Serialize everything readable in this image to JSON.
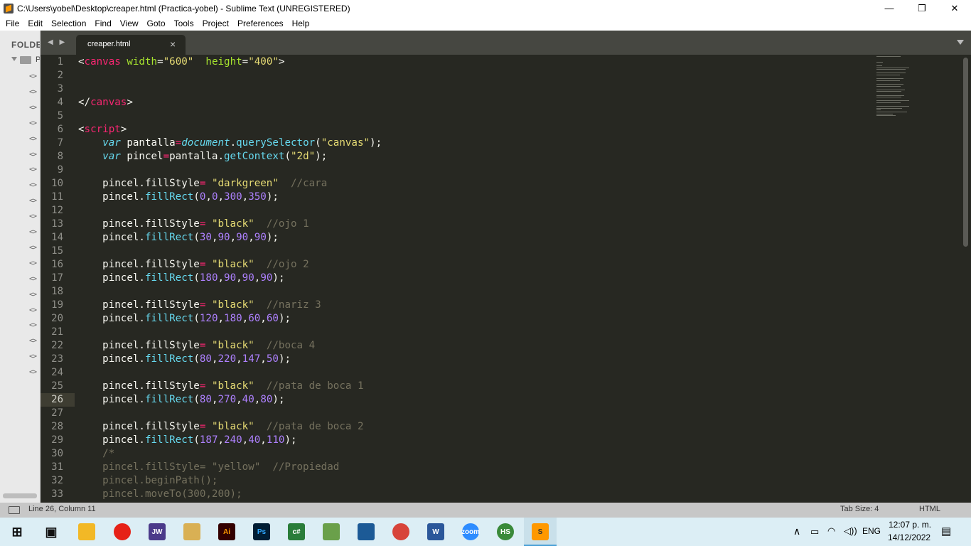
{
  "window": {
    "title": "C:\\Users\\yobel\\Desktop\\creaper.html (Practica-yobel) - Sublime Text (UNREGISTERED)",
    "minimize": "—",
    "maximize": "❐",
    "close": "✕"
  },
  "menu": [
    "File",
    "Edit",
    "Selection",
    "Find",
    "View",
    "Goto",
    "Tools",
    "Project",
    "Preferences",
    "Help"
  ],
  "sidebar": {
    "header": "FOLDE",
    "folder_letter": "P",
    "file_icon_glyph": "<>",
    "file_count": 20
  },
  "tabs": {
    "nav": "◀ ▶",
    "active_tab": "creaper.html",
    "close_glyph": "×"
  },
  "editor": {
    "current_line": 26,
    "lines": [
      [
        [
          "t-plain",
          "<"
        ],
        [
          "t-tag",
          "canvas"
        ],
        [
          "t-plain",
          " "
        ],
        [
          "t-attr",
          "width"
        ],
        [
          "t-plain",
          "="
        ],
        [
          "t-str",
          "\"600\""
        ],
        [
          "t-plain",
          "  "
        ],
        [
          "t-attr",
          "height"
        ],
        [
          "t-plain",
          "="
        ],
        [
          "t-str",
          "\"400\""
        ],
        [
          "t-plain",
          ">"
        ]
      ],
      [],
      [],
      [
        [
          "t-plain",
          "</"
        ],
        [
          "t-tag",
          "canvas"
        ],
        [
          "t-plain",
          ">"
        ]
      ],
      [],
      [
        [
          "t-plain",
          "<"
        ],
        [
          "t-tag",
          "script"
        ],
        [
          "t-plain",
          ">"
        ]
      ],
      [
        [
          "t-plain",
          "    "
        ],
        [
          "t-kw",
          "var"
        ],
        [
          "t-plain",
          " pantalla"
        ],
        [
          "t-op",
          "="
        ],
        [
          "t-glob",
          "document"
        ],
        [
          "t-plain",
          "."
        ],
        [
          "t-fn",
          "querySelector"
        ],
        [
          "t-plain",
          "("
        ],
        [
          "t-str",
          "\"canvas\""
        ],
        [
          "t-plain",
          ");"
        ]
      ],
      [
        [
          "t-plain",
          "    "
        ],
        [
          "t-kw",
          "var"
        ],
        [
          "t-plain",
          " pincel"
        ],
        [
          "t-op",
          "="
        ],
        [
          "t-plain",
          "pantalla."
        ],
        [
          "t-fn",
          "getContext"
        ],
        [
          "t-plain",
          "("
        ],
        [
          "t-str",
          "\"2d\""
        ],
        [
          "t-plain",
          ");"
        ]
      ],
      [],
      [
        [
          "t-plain",
          "    pincel.fillStyle"
        ],
        [
          "t-op",
          "="
        ],
        [
          "t-plain",
          " "
        ],
        [
          "t-str",
          "\"darkgreen\""
        ],
        [
          "t-plain",
          "  "
        ],
        [
          "t-com",
          "//cara"
        ]
      ],
      [
        [
          "t-plain",
          "    pincel."
        ],
        [
          "t-fn",
          "fillRect"
        ],
        [
          "t-plain",
          "("
        ],
        [
          "t-num",
          "0"
        ],
        [
          "t-plain",
          ","
        ],
        [
          "t-num",
          "0"
        ],
        [
          "t-plain",
          ","
        ],
        [
          "t-num",
          "300"
        ],
        [
          "t-plain",
          ","
        ],
        [
          "t-num",
          "350"
        ],
        [
          "t-plain",
          ");"
        ]
      ],
      [],
      [
        [
          "t-plain",
          "    pincel.fillStyle"
        ],
        [
          "t-op",
          "="
        ],
        [
          "t-plain",
          " "
        ],
        [
          "t-str",
          "\"black\""
        ],
        [
          "t-plain",
          "  "
        ],
        [
          "t-com",
          "//ojo 1"
        ]
      ],
      [
        [
          "t-plain",
          "    pincel."
        ],
        [
          "t-fn",
          "fillRect"
        ],
        [
          "t-plain",
          "("
        ],
        [
          "t-num",
          "30"
        ],
        [
          "t-plain",
          ","
        ],
        [
          "t-num",
          "90"
        ],
        [
          "t-plain",
          ","
        ],
        [
          "t-num",
          "90"
        ],
        [
          "t-plain",
          ","
        ],
        [
          "t-num",
          "90"
        ],
        [
          "t-plain",
          ");"
        ]
      ],
      [],
      [
        [
          "t-plain",
          "    pincel.fillStyle"
        ],
        [
          "t-op",
          "="
        ],
        [
          "t-plain",
          " "
        ],
        [
          "t-str",
          "\"black\""
        ],
        [
          "t-plain",
          "  "
        ],
        [
          "t-com",
          "//ojo 2"
        ]
      ],
      [
        [
          "t-plain",
          "    pincel."
        ],
        [
          "t-fn",
          "fillRect"
        ],
        [
          "t-plain",
          "("
        ],
        [
          "t-num",
          "180"
        ],
        [
          "t-plain",
          ","
        ],
        [
          "t-num",
          "90"
        ],
        [
          "t-plain",
          ","
        ],
        [
          "t-num",
          "90"
        ],
        [
          "t-plain",
          ","
        ],
        [
          "t-num",
          "90"
        ],
        [
          "t-plain",
          ");"
        ]
      ],
      [],
      [
        [
          "t-plain",
          "    pincel.fillStyle"
        ],
        [
          "t-op",
          "="
        ],
        [
          "t-plain",
          " "
        ],
        [
          "t-str",
          "\"black\""
        ],
        [
          "t-plain",
          "  "
        ],
        [
          "t-com",
          "//nariz 3"
        ]
      ],
      [
        [
          "t-plain",
          "    pincel."
        ],
        [
          "t-fn",
          "fillRect"
        ],
        [
          "t-plain",
          "("
        ],
        [
          "t-num",
          "120"
        ],
        [
          "t-plain",
          ","
        ],
        [
          "t-num",
          "180"
        ],
        [
          "t-plain",
          ","
        ],
        [
          "t-num",
          "60"
        ],
        [
          "t-plain",
          ","
        ],
        [
          "t-num",
          "60"
        ],
        [
          "t-plain",
          ");"
        ]
      ],
      [],
      [
        [
          "t-plain",
          "    pincel.fillStyle"
        ],
        [
          "t-op",
          "="
        ],
        [
          "t-plain",
          " "
        ],
        [
          "t-str",
          "\"black\""
        ],
        [
          "t-plain",
          "  "
        ],
        [
          "t-com",
          "//boca 4"
        ]
      ],
      [
        [
          "t-plain",
          "    pincel."
        ],
        [
          "t-fn",
          "fillRect"
        ],
        [
          "t-plain",
          "("
        ],
        [
          "t-num",
          "80"
        ],
        [
          "t-plain",
          ","
        ],
        [
          "t-num",
          "220"
        ],
        [
          "t-plain",
          ","
        ],
        [
          "t-num",
          "147"
        ],
        [
          "t-plain",
          ","
        ],
        [
          "t-num",
          "50"
        ],
        [
          "t-plain",
          ");"
        ]
      ],
      [],
      [
        [
          "t-plain",
          "    pincel.fillStyle"
        ],
        [
          "t-op",
          "="
        ],
        [
          "t-plain",
          " "
        ],
        [
          "t-str",
          "\"black\""
        ],
        [
          "t-plain",
          "  "
        ],
        [
          "t-com",
          "//pata de boca 1"
        ]
      ],
      [
        [
          "t-plain",
          "    pincel."
        ],
        [
          "t-fn",
          "fillRect"
        ],
        [
          "t-plain",
          "("
        ],
        [
          "t-num",
          "80"
        ],
        [
          "t-plain",
          ","
        ],
        [
          "t-num",
          "270"
        ],
        [
          "t-plain",
          ","
        ],
        [
          "t-num",
          "40"
        ],
        [
          "t-plain",
          ","
        ],
        [
          "t-num",
          "80"
        ],
        [
          "t-plain",
          ");"
        ]
      ],
      [],
      [
        [
          "t-plain",
          "    pincel.fillStyle"
        ],
        [
          "t-op",
          "="
        ],
        [
          "t-plain",
          " "
        ],
        [
          "t-str",
          "\"black\""
        ],
        [
          "t-plain",
          "  "
        ],
        [
          "t-com",
          "//pata de boca 2"
        ]
      ],
      [
        [
          "t-plain",
          "    pincel."
        ],
        [
          "t-fn",
          "fillRect"
        ],
        [
          "t-plain",
          "("
        ],
        [
          "t-num",
          "187"
        ],
        [
          "t-plain",
          ","
        ],
        [
          "t-num",
          "240"
        ],
        [
          "t-plain",
          ","
        ],
        [
          "t-num",
          "40"
        ],
        [
          "t-plain",
          ","
        ],
        [
          "t-num",
          "110"
        ],
        [
          "t-plain",
          ");"
        ]
      ],
      [
        [
          "t-com",
          "    /*"
        ]
      ],
      [
        [
          "t-com",
          "    pincel.fillStyle= \"yellow\"  //Propiedad"
        ]
      ],
      [
        [
          "t-com",
          "    pincel.beginPath();"
        ]
      ],
      [
        [
          "t-com",
          "    pincel.moveTo(300,200);"
        ]
      ]
    ]
  },
  "status": {
    "position": "Line 26, Column 11",
    "tab_size": "Tab Size: 4",
    "syntax": "HTML"
  },
  "taskbar": {
    "apps": [
      {
        "name": "start-icon",
        "label": ""
      },
      {
        "name": "task-view-icon",
        "label": ""
      },
      {
        "name": "file-explorer-icon",
        "label": ""
      },
      {
        "name": "youtube-icon",
        "label": ""
      },
      {
        "name": "jw-icon",
        "label": "JW"
      },
      {
        "name": "notepad-icon",
        "label": ""
      },
      {
        "name": "illustrator-icon",
        "label": "Ai"
      },
      {
        "name": "photoshop-icon",
        "label": "Ps"
      },
      {
        "name": "visual-c-icon",
        "label": "c#"
      },
      {
        "name": "paint-icon",
        "label": ""
      },
      {
        "name": "virtualbox-icon",
        "label": ""
      },
      {
        "name": "chrome-icon",
        "label": ""
      },
      {
        "name": "word-icon",
        "label": "W"
      },
      {
        "name": "zoom-icon",
        "label": "zoom"
      },
      {
        "name": "hs-icon",
        "label": "HS"
      },
      {
        "name": "sublime-icon",
        "label": "S"
      }
    ],
    "language": "ENG",
    "time": "12:07 p. m.",
    "date": "14/12/2022"
  }
}
